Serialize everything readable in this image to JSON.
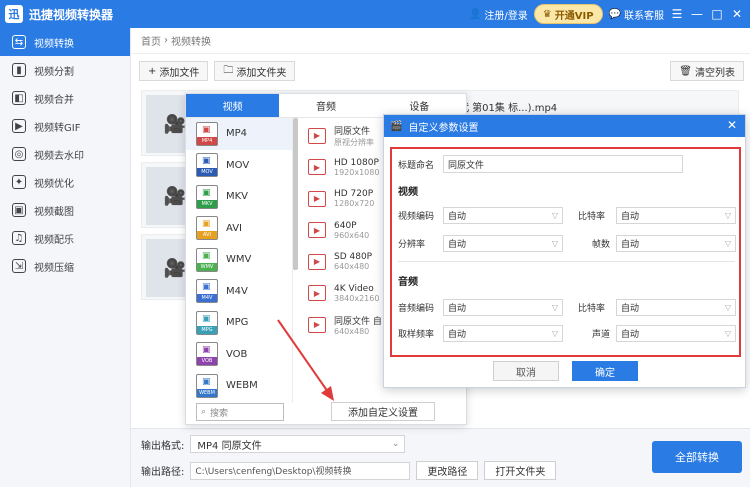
{
  "app": {
    "title": "迅捷视频转换器",
    "logo": "迅"
  },
  "titlebar": {
    "login": "注册/登录",
    "vip": "开通VIP",
    "service": "联系客服",
    "menu": "☰",
    "minimize": "—",
    "maximize": "□",
    "close": "✕"
  },
  "sidebar": {
    "items": [
      {
        "label": "视频转换",
        "icon": "⇆"
      },
      {
        "label": "视频分割",
        "icon": "▮"
      },
      {
        "label": "视频合并",
        "icon": "◧"
      },
      {
        "label": "视频转GIF",
        "icon": "▶"
      },
      {
        "label": "视频去水印",
        "icon": "◎"
      },
      {
        "label": "视频优化",
        "icon": "✦"
      },
      {
        "label": "视频截图",
        "icon": "▣"
      },
      {
        "label": "视频配乐",
        "icon": "♫"
      },
      {
        "label": "视频压缩",
        "icon": "⇲"
      }
    ]
  },
  "breadcrumb": {
    "home": "首页",
    "sep": "›",
    "current": "视频转换"
  },
  "toolbar": {
    "add_file": "添加文件",
    "add_folder": "添加文件夹",
    "clear": "清空列表"
  },
  "files": {
    "name": "代 第01集 标...).mp4"
  },
  "bottom": {
    "format_label": "输出格式:",
    "format_value": "MP4  同原文件",
    "path_label": "输出路径:",
    "path_value": "C:\\Users\\cenfeng\\Desktop\\视频转换",
    "change_path": "更改路径",
    "open_folder": "打开文件夹",
    "convert_all": "全部转换"
  },
  "popup": {
    "tabs": [
      "视频",
      "音频",
      "设备"
    ],
    "formats": [
      {
        "label": "MP4",
        "color": "#d04848"
      },
      {
        "label": "MOV",
        "color": "#2a5bb5"
      },
      {
        "label": "MKV",
        "color": "#2e9e4a"
      },
      {
        "label": "AVI",
        "color": "#e6a120"
      },
      {
        "label": "WMV",
        "color": "#4caf50"
      },
      {
        "label": "M4V",
        "color": "#3b6fd1"
      },
      {
        "label": "MPG",
        "color": "#3aa0b8"
      },
      {
        "label": "VOB",
        "color": "#8e44ad"
      },
      {
        "label": "WEBM",
        "color": "#3577c8"
      }
    ],
    "resolutions": [
      {
        "name": "同原文件",
        "sub": "原视分辨率"
      },
      {
        "name": "HD 1080P",
        "sub": "1920x1080"
      },
      {
        "name": "HD 720P",
        "sub": "1280x720"
      },
      {
        "name": "640P",
        "sub": "960x640"
      },
      {
        "name": "SD 480P",
        "sub": "640x480"
      },
      {
        "name": "4K Video",
        "sub": "3840x2160"
      },
      {
        "name": "同原文件 自",
        "sub": "640x480"
      }
    ],
    "search_placeholder": "搜索",
    "add_custom": "添加自定义设置"
  },
  "dialog": {
    "title": "自定义参数设置",
    "name_label": "标题命名",
    "name_value": "同原文件",
    "video_section": "视频",
    "audio_section": "音频",
    "video_codec_label": "视频编码",
    "bitrate_label": "比特率",
    "resolution_label": "分辨率",
    "fps_label": "帧数",
    "audio_codec_label": "音频编码",
    "audio_bitrate_label": "比特率",
    "sample_rate_label": "取样频率",
    "channel_label": "声道",
    "auto": "自动",
    "cancel": "取消",
    "ok": "确定"
  },
  "colors": {
    "accent": "#2a7be4",
    "highlight": "#e03a3a"
  }
}
